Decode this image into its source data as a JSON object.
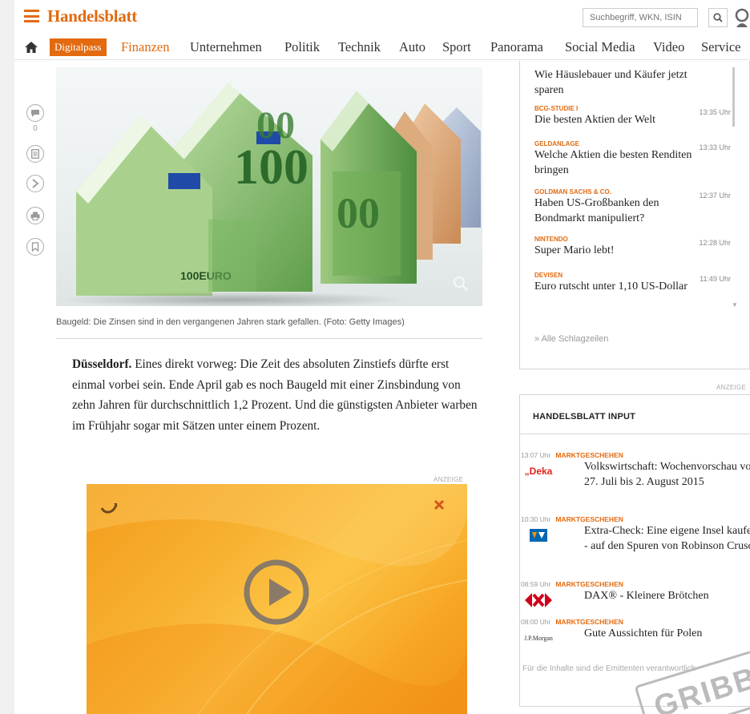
{
  "header": {
    "logo": "Handelsblatt",
    "search_placeholder": "Suchbegriff, WKN, ISIN"
  },
  "nav": {
    "digitalpass": "Digitalpass",
    "items": [
      "Finanzen",
      "Unternehmen",
      "Politik",
      "Technik",
      "Auto",
      "Sport",
      "Panorama",
      "Social Media",
      "Video",
      "Service"
    ],
    "active": "Finanzen"
  },
  "social": {
    "comment_count": "0"
  },
  "article": {
    "image_caption": "Baugeld: Die Zinsen sind in den vergangenen Jahren stark gefallen. (Foto: Getty Images)",
    "dateline": "Düsseldorf.",
    "text": "Eines direkt vorweg: Die Zeit des absoluten Zinstiefs dürfte erst einmal vorbei sein. Ende April gab es noch Baugeld mit einer Zinsbindung von zehn Jahren für durchschnittlich 1,2 Prozent. Und die günstigsten Anbieter warben im Frühjahr sogar mit Sätzen unter einem Prozent.",
    "ad_label": "ANZEIGE"
  },
  "headlines": {
    "items": [
      {
        "kicker": "",
        "time": "",
        "title": "Wie Häuslebauer und Käufer jetzt sparen"
      },
      {
        "kicker": "BCG-STUDIE I",
        "time": "13:35 Uhr",
        "title": "Die besten Aktien der Welt"
      },
      {
        "kicker": "GELDANLAGE",
        "time": "13:33 Uhr",
        "title": "Welche Aktien die besten Renditen bringen"
      },
      {
        "kicker": "GOLDMAN SACHS & CO.",
        "time": "12:37 Uhr",
        "title": "Haben US-Großbanken den Bondmarkt manipuliert?"
      },
      {
        "kicker": "NINTENDO",
        "time": "12:28 Uhr",
        "title": "Super Mario lebt!"
      },
      {
        "kicker": "DEVISEN",
        "time": "11:49 Uhr",
        "title": "Euro rutscht unter 1,10 US-Dollar"
      }
    ],
    "all_link": "» Alle Schlagzeilen"
  },
  "input": {
    "ad_label": "ANZEIGE",
    "title": "HANDELSBLATT INPUT",
    "items": [
      {
        "time": "13:07 Uhr",
        "category": "MARKTGESCHEHEN",
        "issuer": "Deka",
        "title": "Volkswirtschaft: Wochenvorschau vom 27. Juli bis 2. August 2015"
      },
      {
        "time": "10:30 Uhr",
        "category": "MARKTGESCHEHEN",
        "issuer": "Volksbank",
        "title": "Extra-Check: Eine eigene Insel kaufen - auf den Spuren von Robinson Crusoe"
      },
      {
        "time": "08:59 Uhr",
        "category": "MARKTGESCHEHEN",
        "issuer": "Deutsche Bank",
        "title": "DAX® - Kleinere Brötchen"
      },
      {
        "time": "08:00 Uhr",
        "category": "MARKTGESCHEHEN",
        "issuer": "J.P.Morgan",
        "title": "Gute Aussichten für Polen"
      }
    ],
    "footer": "Für die Inhalte sind die Emittenten verantwortlich",
    "stamp": "GRIBB"
  },
  "colors": {
    "brand": "#e36a0f"
  }
}
